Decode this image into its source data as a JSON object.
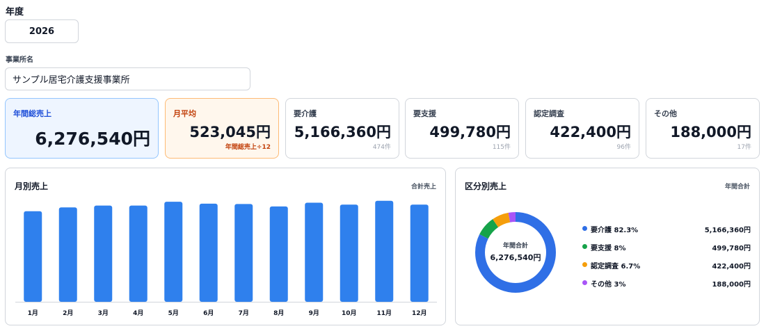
{
  "filters": {
    "year_label": "年度",
    "year_value": "2026",
    "office_label": "事業所名",
    "office_value": "サンプル居宅介護支援事業所"
  },
  "cards": {
    "annual": {
      "title": "年間総売上",
      "value": "6,276,540円"
    },
    "monthly_avg": {
      "title": "月平均",
      "value": "523,045円",
      "sub": "年間総売上÷12"
    },
    "kaigo": {
      "title": "要介護",
      "value": "5,166,360円",
      "sub": "474件"
    },
    "shien": {
      "title": "要支援",
      "value": "499,780円",
      "sub": "115件"
    },
    "chosa": {
      "title": "認定調査",
      "value": "422,400円",
      "sub": "96件"
    },
    "other": {
      "title": "その他",
      "value": "188,000円",
      "sub": "17件"
    }
  },
  "monthly_panel": {
    "title": "月別売上",
    "right_label": "合計売上"
  },
  "category_panel": {
    "title": "区分別売上",
    "right_label": "年間合計",
    "center_label": "年間合計",
    "center_value": "6,276,540円",
    "legend": [
      {
        "name": "要介護 82.3%",
        "value": "5,166,360円",
        "color": "#2f6fe6"
      },
      {
        "name": "要支援 8%",
        "value": "499,780円",
        "color": "#16a34a"
      },
      {
        "name": "認定調査 6.7%",
        "value": "422,400円",
        "color": "#f59e0b"
      },
      {
        "name": "その他 3%",
        "value": "188,000円",
        "color": "#a855f7"
      }
    ]
  },
  "chart_data": [
    {
      "type": "bar",
      "title": "月別売上",
      "categories": [
        "1月",
        "2月",
        "3月",
        "4月",
        "5月",
        "6月",
        "7月",
        "8月",
        "9月",
        "10月",
        "11月",
        "12月"
      ],
      "values": [
        480000,
        500000,
        510000,
        510000,
        530000,
        520000,
        518000,
        505000,
        525000,
        515000,
        535000,
        515000
      ],
      "ylim": [
        0,
        560000
      ],
      "grid": false,
      "color": "#2f80ed"
    },
    {
      "type": "pie",
      "title": "区分別売上",
      "categories": [
        "要介護",
        "要支援",
        "認定調査",
        "その他"
      ],
      "values": [
        5166360,
        499780,
        422400,
        188000
      ],
      "colors": [
        "#2f6fe6",
        "#16a34a",
        "#f59e0b",
        "#a855f7"
      ]
    }
  ]
}
